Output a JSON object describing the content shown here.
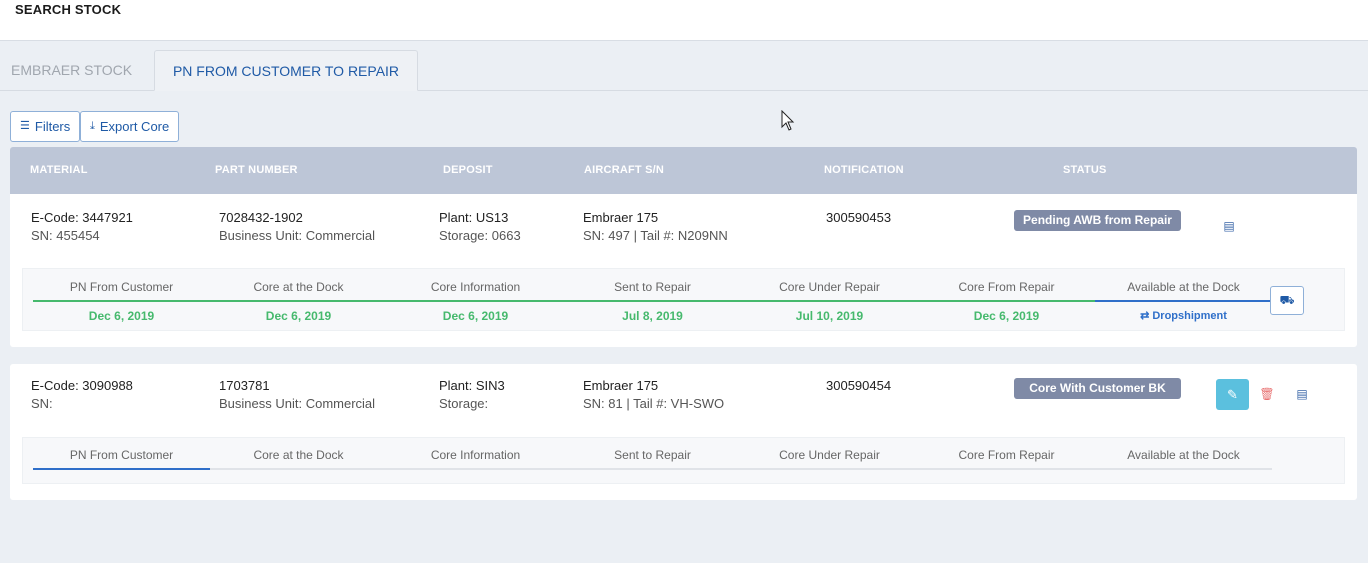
{
  "header": {
    "title": "SEARCH STOCK"
  },
  "tabs": [
    {
      "label": "EMBRAER STOCK",
      "active": false
    },
    {
      "label": "PN FROM CUSTOMER TO REPAIR",
      "active": true
    }
  ],
  "toolbar": {
    "filters_label": "Filters",
    "export_label": "Export Core"
  },
  "table": {
    "columns": [
      "MATERIAL",
      "PART NUMBER",
      "DEPOSIT",
      "AIRCRAFT S/N",
      "NOTIFICATION",
      "STATUS"
    ],
    "rows": [
      {
        "material": {
          "ecode": "E-Code: 3447921",
          "sn": "SN: 455454"
        },
        "part_number": {
          "pn": "7028432-1902",
          "bu": "Business Unit: Commercial"
        },
        "deposit": {
          "plant": "Plant: US13",
          "storage": "Storage: 0663"
        },
        "aircraft": {
          "model": "Embraer 175",
          "sn": "SN: 497 | Tail #: N209NN"
        },
        "notification": "300590453",
        "status": "Pending AWB from Repair",
        "steps": [
          {
            "label": "PN From Customer",
            "date": "Dec 6, 2019"
          },
          {
            "label": "Core at the Dock",
            "date": "Dec 6, 2019"
          },
          {
            "label": "Core Information",
            "date": "Dec 6, 2019"
          },
          {
            "label": "Sent to Repair",
            "date": "Jul 8, 2019"
          },
          {
            "label": "Core Under Repair",
            "date": "Jul 10, 2019"
          },
          {
            "label": "Core From Repair",
            "date": "Dec 6, 2019"
          },
          {
            "label": "Available at the Dock",
            "date": "Dropshipment"
          }
        ]
      },
      {
        "material": {
          "ecode": "E-Code: 3090988",
          "sn": "SN:"
        },
        "part_number": {
          "pn": "1703781",
          "bu": "Business Unit: Commercial"
        },
        "deposit": {
          "plant": "Plant: SIN3",
          "storage": "Storage:"
        },
        "aircraft": {
          "model": "Embraer 175",
          "sn": "SN: 81 | Tail #: VH-SWO"
        },
        "notification": "300590454",
        "status": "Core With Customer BK",
        "steps": [
          {
            "label": "PN From Customer"
          },
          {
            "label": "Core at the Dock"
          },
          {
            "label": "Core Information"
          },
          {
            "label": "Sent to Repair"
          },
          {
            "label": "Core Under Repair"
          },
          {
            "label": "Core From Repair"
          },
          {
            "label": "Available at the Dock"
          }
        ]
      }
    ]
  },
  "colors": {
    "accent": "#1f5aa6",
    "header_bg": "#bdc6d7",
    "badge": "#7f8aa6",
    "done": "#46b96d",
    "edit": "#5bc0de"
  }
}
